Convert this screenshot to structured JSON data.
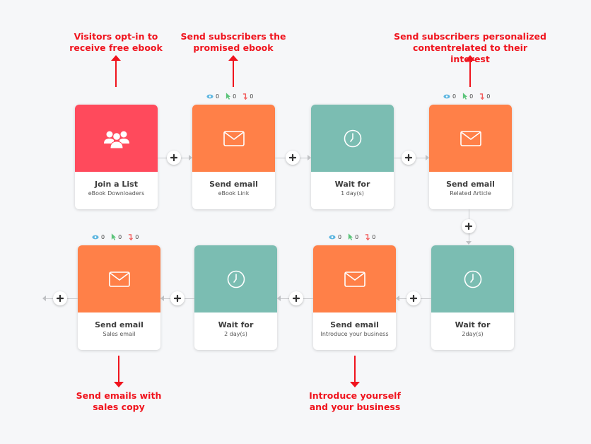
{
  "annotations": {
    "top1": [
      "Visitors opt-in to",
      "receive free ebook"
    ],
    "top2": [
      "Send subscribers the",
      "promised ebook"
    ],
    "top3": [
      "Send subscribers personalized",
      "contentrelated to their interest"
    ],
    "bottom1": [
      "Send emails with",
      "sales copy"
    ],
    "bottom2": [
      "Introduce yourself",
      "and your business"
    ]
  },
  "stats": {
    "opens": "0",
    "clicks": "0",
    "bounces": "0"
  },
  "colors": {
    "list": "#ff4a5c",
    "email": "#ff8048",
    "wait": "#7bbdb2",
    "annotation": "#f0141e"
  },
  "nodes": [
    {
      "type": "list",
      "icon": "users-icon",
      "title": "Join a List",
      "subtitle": "eBook Downloaders"
    },
    {
      "type": "email",
      "icon": "envelope-icon",
      "title": "Send email",
      "subtitle": "eBook Link"
    },
    {
      "type": "wait",
      "icon": "clock-icon",
      "title": "Wait for",
      "subtitle": "1 day(s)"
    },
    {
      "type": "email",
      "icon": "envelope-icon",
      "title": "Send email",
      "subtitle": "Related Article"
    },
    {
      "type": "wait",
      "icon": "clock-icon",
      "title": "Wait for",
      "subtitle": "2day(s)"
    },
    {
      "type": "email",
      "icon": "envelope-icon",
      "title": "Send email",
      "subtitle": "Introduce your business"
    },
    {
      "type": "wait",
      "icon": "clock-icon",
      "title": "Wait for",
      "subtitle": "2 day(s)"
    },
    {
      "type": "email",
      "icon": "envelope-icon",
      "title": "Send email",
      "subtitle": "Sales email"
    }
  ]
}
